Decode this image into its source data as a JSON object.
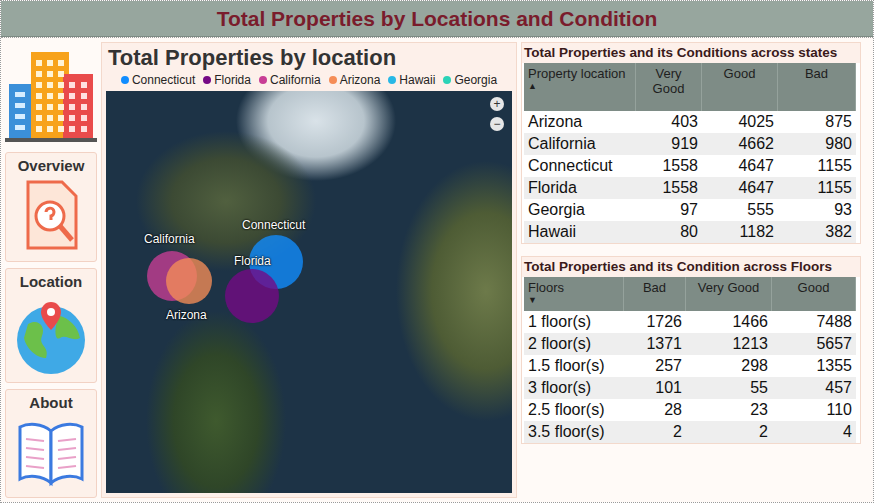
{
  "window": {
    "title": "Total Properties by Locations and Condition"
  },
  "sidebar": {
    "items": [
      {
        "label": "Overview",
        "kind": "overview"
      },
      {
        "label": "Location",
        "kind": "location"
      },
      {
        "label": "About",
        "kind": "about"
      }
    ]
  },
  "map_panel": {
    "title": "Total Properties by location",
    "legend": [
      {
        "name": "Connecticut",
        "color": "#118dff"
      },
      {
        "name": "Florida",
        "color": "#750985"
      },
      {
        "name": "California",
        "color": "#c83d95"
      },
      {
        "name": "Arizona",
        "color": "#f58d57"
      },
      {
        "name": "Hawaii",
        "color": "#28b8e6"
      },
      {
        "name": "Georgia",
        "color": "#2bd3b7"
      }
    ],
    "bubbles": [
      {
        "label": "California",
        "value": 6561,
        "color": "#c83d95"
      },
      {
        "label": "Arizona",
        "value": 5303,
        "color": "#f58d57"
      },
      {
        "label": "Connecticut",
        "value": 7360,
        "color": "#118dff"
      },
      {
        "label": "Florida",
        "value": 7360,
        "color": "#750985"
      }
    ],
    "zoom": [
      "+",
      "−"
    ]
  },
  "states_table": {
    "title": "Total Properties and its Conditions across states",
    "sort_mark": "▲",
    "columns": [
      "Property location",
      "Very Good",
      "Good",
      "Bad"
    ],
    "rows": [
      [
        "Arizona",
        "403",
        "4025",
        "875"
      ],
      [
        "California",
        "919",
        "4662",
        "980"
      ],
      [
        "Connecticut",
        "1558",
        "4647",
        "1155"
      ],
      [
        "Florida",
        "1558",
        "4647",
        "1155"
      ],
      [
        "Georgia",
        "97",
        "555",
        "93"
      ],
      [
        "Hawaii",
        "80",
        "1182",
        "382"
      ]
    ]
  },
  "floors_table": {
    "title": "Total Properties and its Condition across Floors",
    "sort_mark": "▼",
    "columns": [
      "Floors",
      "Bad",
      "Very Good",
      "Good"
    ],
    "rows": [
      [
        "1 floor(s)",
        "1726",
        "1466",
        "7488"
      ],
      [
        "2 floor(s)",
        "1371",
        "1213",
        "5657"
      ],
      [
        "1.5 floor(s)",
        "257",
        "298",
        "1355"
      ],
      [
        "3 floor(s)",
        "101",
        "55",
        "457"
      ],
      [
        "2.5 floor(s)",
        "28",
        "23",
        "110"
      ],
      [
        "3.5 floor(s)",
        "2",
        "2",
        "4"
      ]
    ]
  }
}
